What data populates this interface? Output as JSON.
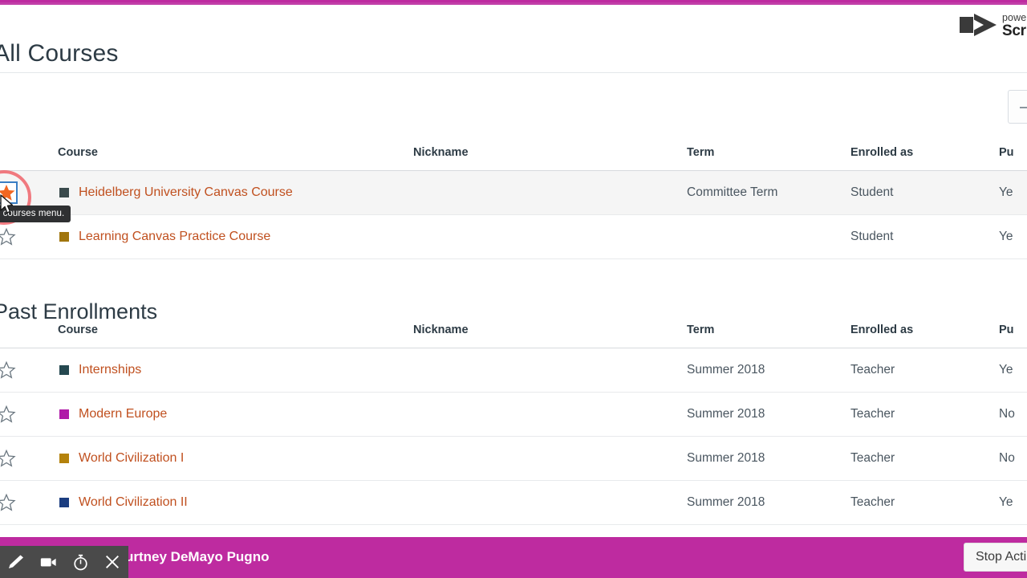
{
  "brand": {
    "line1": "powe",
    "line2": "Scr",
    "mark_icon": "play-button-icon"
  },
  "page": {
    "title": "All Courses",
    "section_title": "Past Enrollments"
  },
  "toolbar": {
    "add_course_label": "+",
    "add_course_icon": "plus-icon"
  },
  "columns": {
    "course": "Course",
    "nickname": "Nickname",
    "term": "Term",
    "enrolled_as": "Enrolled as",
    "published": "Pu"
  },
  "current_courses": [
    {
      "favorite": true,
      "focused": true,
      "color": "#3B4B4D",
      "name": "Heidelberg University Canvas Course",
      "nickname": "",
      "term": "Committee Term",
      "enrolled_as": "Student",
      "published": "Ye"
    },
    {
      "favorite": false,
      "focused": false,
      "color": "#A0750D",
      "name": "Learning Canvas Practice Course",
      "nickname": "",
      "term": "",
      "enrolled_as": "Student",
      "published": "Ye"
    }
  ],
  "past_courses": [
    {
      "favorite": false,
      "color": "#254850",
      "name": "Internships",
      "nickname": "",
      "term": "Summer 2018",
      "enrolled_as": "Teacher",
      "published": "Ye"
    },
    {
      "favorite": false,
      "color": "#B01AA8",
      "name": "Modern Europe",
      "nickname": "",
      "term": "Summer 2018",
      "enrolled_as": "Teacher",
      "published": "No"
    },
    {
      "favorite": false,
      "color": "#B4820C",
      "name": "World Civilization I",
      "nickname": "",
      "term": "Summer 2018",
      "enrolled_as": "Teacher",
      "published": "No"
    },
    {
      "favorite": false,
      "color": "#1B3D80",
      "name": "World Civilization II",
      "nickname": "",
      "term": "Summer 2018",
      "enrolled_as": "Teacher",
      "published": "Ye"
    }
  ],
  "tooltip": {
    "text": "the courses menu."
  },
  "recorder": {
    "user_name": "urtney DeMayo Pugno",
    "stop_label": "Stop Acti",
    "buttons": [
      {
        "icon": "pen-icon"
      },
      {
        "icon": "video-camera-icon"
      },
      {
        "icon": "stopwatch-icon"
      },
      {
        "icon": "close-icon"
      }
    ]
  },
  "colors": {
    "brand_magenta": "#BE2BA0",
    "link_orange": "#C0501F",
    "annotation_red": "#EF4A52",
    "favorite_star": "#F26722"
  }
}
